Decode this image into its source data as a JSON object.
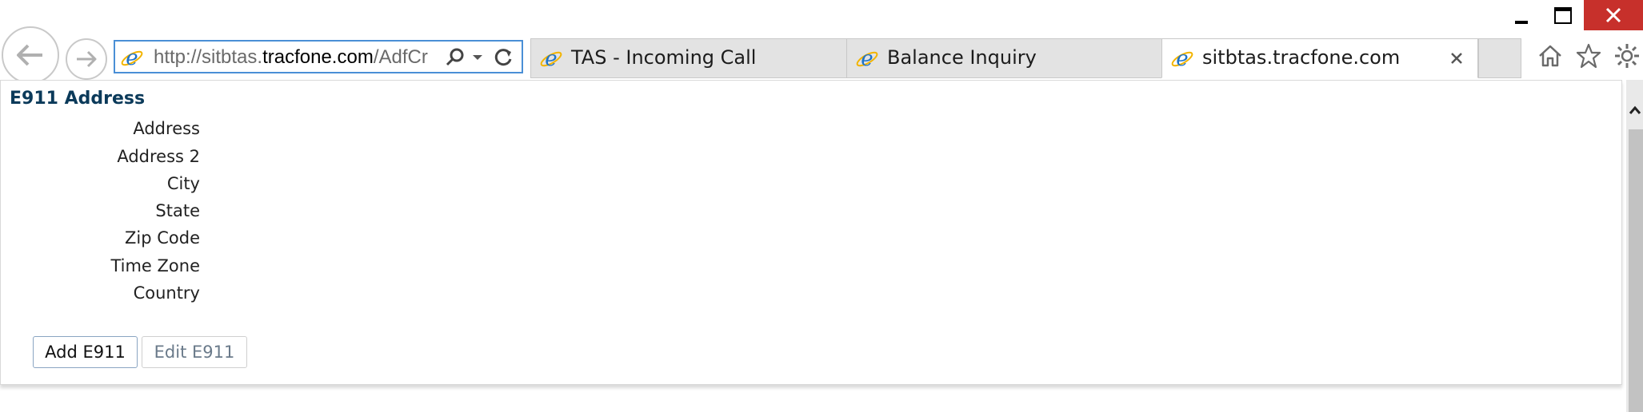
{
  "window": {
    "minimize": "minimize",
    "maximize": "maximize",
    "close": "close"
  },
  "address_bar": {
    "url_prefix": "http://sitbtas.",
    "url_domain": "tracfone.com",
    "url_suffix": "/AdfCr"
  },
  "tabs": [
    {
      "label": "TAS - Incoming Call",
      "active": false
    },
    {
      "label": "Balance Inquiry",
      "active": false
    },
    {
      "label": "sitbtas.tracfone.com",
      "active": true
    }
  ],
  "panel": {
    "title": "E911 Address",
    "fields": [
      "Address",
      "Address 2",
      "City",
      "State",
      "Zip Code",
      "Time Zone",
      "Country"
    ],
    "buttons": {
      "add": "Add E911",
      "edit": "Edit E911"
    }
  },
  "colors": {
    "title": "#0b3a5a",
    "close_button": "#c7302b",
    "ie_logo": "#1e73c8",
    "address_focus": "#4a8fd6"
  },
  "icons": [
    "back-arrow-icon",
    "forward-arrow-icon",
    "ie-logo-icon",
    "search-icon",
    "dropdown-icon",
    "refresh-icon",
    "close-icon",
    "home-icon",
    "star-icon",
    "gear-icon"
  ]
}
